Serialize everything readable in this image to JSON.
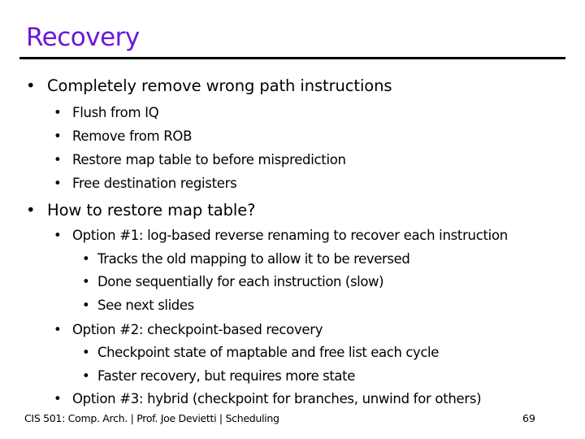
{
  "slide": {
    "title": "Recovery",
    "bullets": [
      {
        "text": "Completely remove wrong path instructions",
        "children": [
          {
            "text": "Flush from IQ"
          },
          {
            "text": "Remove from ROB"
          },
          {
            "text": "Restore map table to before misprediction"
          },
          {
            "text": "Free destination registers"
          }
        ]
      },
      {
        "text": "How to restore map table?",
        "children": [
          {
            "text": "Option #1: log-based reverse renaming to recover each instruction",
            "children": [
              {
                "text": "Tracks the old mapping to allow it to be reversed"
              },
              {
                "text": "Done sequentially for each instruction (slow)"
              },
              {
                "text": "See next slides"
              }
            ]
          },
          {
            "text": "Option #2: checkpoint-based recovery",
            "children": [
              {
                "text": "Checkpoint state of maptable and free list each cycle"
              },
              {
                "text": "Faster recovery, but requires more state"
              }
            ]
          },
          {
            "text": "Option #3: hybrid (checkpoint for branches, unwind for others)"
          }
        ]
      }
    ],
    "bullet_glyph": "•",
    "title_color": "#6a18d8"
  },
  "footer": {
    "text": "CIS 501: Comp. Arch.  |  Prof. Joe Devietti  |  Scheduling",
    "page_number": "69"
  }
}
